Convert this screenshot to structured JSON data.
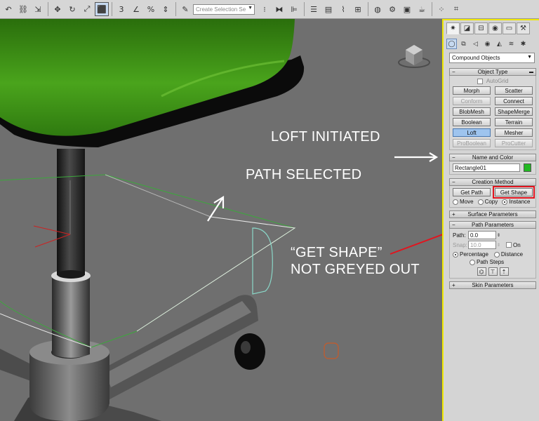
{
  "toolbar": {
    "selection_set_placeholder": "Create Selection Se",
    "snap_label": "3",
    "percent_label": "%"
  },
  "command_panel": {
    "category_dropdown": "Compound Objects",
    "object_type": {
      "title": "Object Type",
      "autogrid_label": "AutoGrid",
      "buttons": [
        {
          "label": "Morph",
          "state": "normal"
        },
        {
          "label": "Scatter",
          "state": "normal"
        },
        {
          "label": "Conform",
          "state": "disabled"
        },
        {
          "label": "Connect",
          "state": "normal"
        },
        {
          "label": "BlobMesh",
          "state": "normal"
        },
        {
          "label": "ShapeMerge",
          "state": "normal"
        },
        {
          "label": "Boolean",
          "state": "normal"
        },
        {
          "label": "Terrain",
          "state": "normal"
        },
        {
          "label": "Loft",
          "state": "active"
        },
        {
          "label": "Mesher",
          "state": "normal"
        },
        {
          "label": "ProBoolean",
          "state": "disabled"
        },
        {
          "label": "ProCutter",
          "state": "disabled"
        }
      ]
    },
    "name_and_color": {
      "title": "Name and Color",
      "name_value": "Rectangle01",
      "color": "#22b822"
    },
    "creation_method": {
      "title": "Creation Method",
      "get_path_label": "Get Path",
      "get_shape_label": "Get Shape",
      "move_label": "Move",
      "copy_label": "Copy",
      "instance_label": "Instance"
    },
    "surface_parameters": {
      "title": "Surface Parameters"
    },
    "path_parameters": {
      "title": "Path Parameters",
      "path_label": "Path:",
      "path_value": "0.0",
      "snap_label": "Snap:",
      "snap_value": "10.0",
      "on_label": "On",
      "percentage_label": "Percentage",
      "distance_label": "Distance",
      "path_steps_label": "Path Steps"
    },
    "skin_parameters": {
      "title": "Skin Parameters"
    }
  },
  "annotations": {
    "loft_initiated": "LOFT INITIATED",
    "path_selected": "PATH SELECTED",
    "get_shape_line1": "“GET SHAPE”",
    "get_shape_line2": "NOT GREYED OUT"
  },
  "colors": {
    "viewport_bg": "#6f6f6f",
    "seat_green": "#3a8a14",
    "highlight_red": "#e2141e",
    "active_border_yellow": "#f0e800"
  }
}
